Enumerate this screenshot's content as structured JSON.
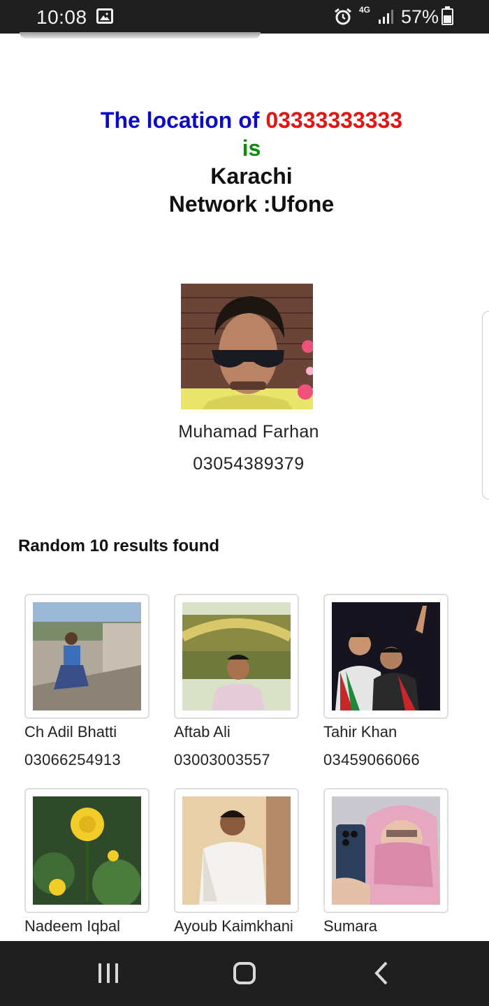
{
  "status_bar": {
    "time": "10:08",
    "network": "4G",
    "battery": "57%",
    "battery_level": 0.57,
    "icons": [
      "gallery-icon",
      "alarm-icon",
      "signal-icon",
      "battery-icon"
    ]
  },
  "headline": {
    "prefix": "The location of ",
    "number": "03333333333",
    "is": "is",
    "city": "Karachi",
    "network": "Network :Ufone",
    "colors": {
      "prefix": "#0a0ac8",
      "number": "#e21414",
      "is": "#0b8a0b"
    }
  },
  "profile": {
    "name": "Muhamad Farhan",
    "phone": "03054389379"
  },
  "results": {
    "title": "Random 10 results found",
    "items": [
      {
        "name": "Ch Adil Bhatti",
        "phone": "03066254913"
      },
      {
        "name": "Aftab Ali",
        "phone": "03003003557"
      },
      {
        "name": "Tahir Khan",
        "phone": "03459066066"
      },
      {
        "name": "Nadeem Iqbal",
        "phone": ""
      },
      {
        "name": "Ayoub Kaimkhani",
        "phone": ""
      },
      {
        "name": "Sumara",
        "phone": ""
      }
    ]
  },
  "nav_bar": {
    "icons": [
      "recent-apps-icon",
      "home-icon",
      "back-icon"
    ]
  }
}
